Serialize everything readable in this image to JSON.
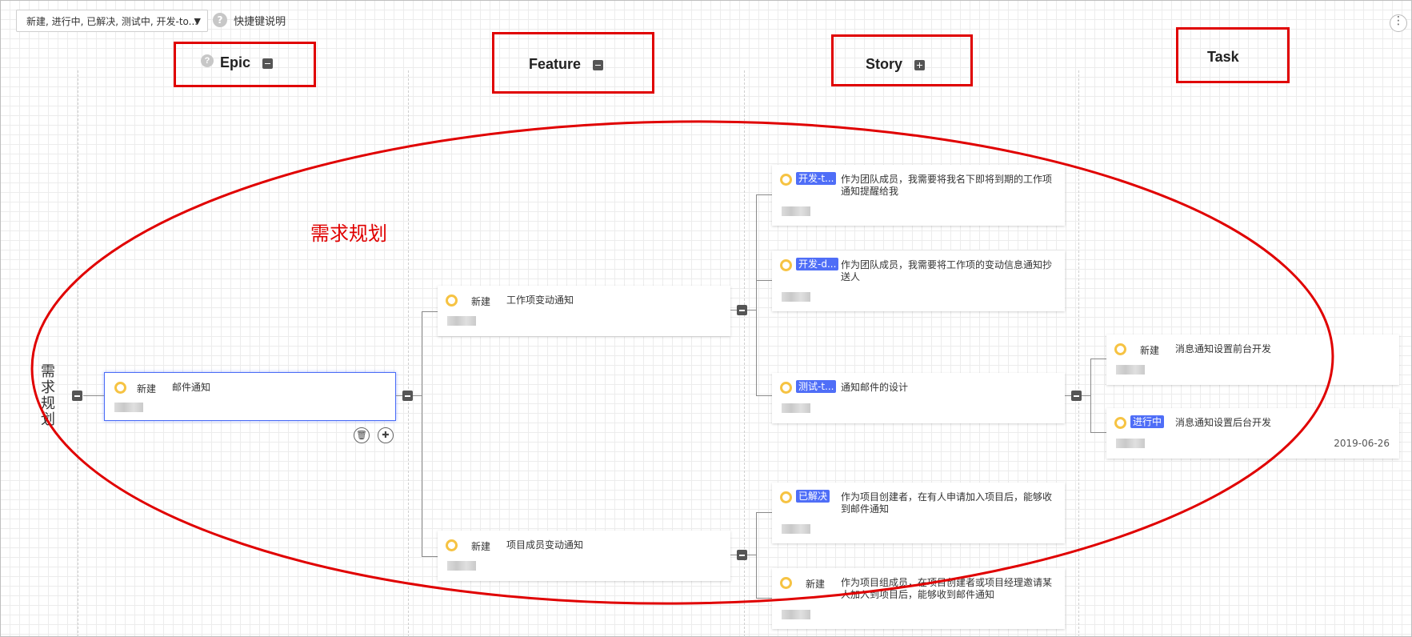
{
  "toolbar": {
    "filter_value": "新建, 进行中, 已解决, 测试中, 开发-to...",
    "help_icon": "?",
    "shortcut_label": "快捷键说明",
    "more_icon": "⋮"
  },
  "columns": {
    "epic": "Epic",
    "feature": "Feature",
    "story": "Story",
    "task": "Task"
  },
  "annotation": "需求规划",
  "root": {
    "label": "需求规划"
  },
  "epic_card": {
    "status": "新建",
    "title": "邮件通知"
  },
  "features": [
    {
      "status": "新建",
      "title": "工作项变动通知"
    },
    {
      "status": "新建",
      "title": "项目成员变动通知"
    }
  ],
  "stories": [
    {
      "status": "开发-t...",
      "title": "作为团队成员，我需要将我名下即将到期的工作项通知提醒给我"
    },
    {
      "status": "开发-d...",
      "title": "作为团队成员，我需要将工作项的变动信息通知抄送人"
    },
    {
      "status": "测试-t...",
      "title": "通知邮件的设计"
    },
    {
      "status": "已解决",
      "title": "作为项目创建者，在有人申请加入项目后，能够收到邮件通知"
    },
    {
      "status": "新建",
      "title": "作为项目组成员，在项目创建者或项目经理邀请某人加入到项目后，能够收到邮件通知"
    }
  ],
  "tasks": [
    {
      "status": "新建",
      "title": "消息通知设置前台开发"
    },
    {
      "status": "进行中",
      "title": "消息通知设置后台开发",
      "date": "2019-06-26"
    }
  ],
  "icons": {
    "delete": "trash-icon",
    "add_child": "add-child-icon"
  },
  "colors": {
    "annotation_red": "#e00000",
    "status_tag": "#4f6ef7",
    "status_ring": "#f6c343",
    "selected_border": "#4a6cf7"
  }
}
